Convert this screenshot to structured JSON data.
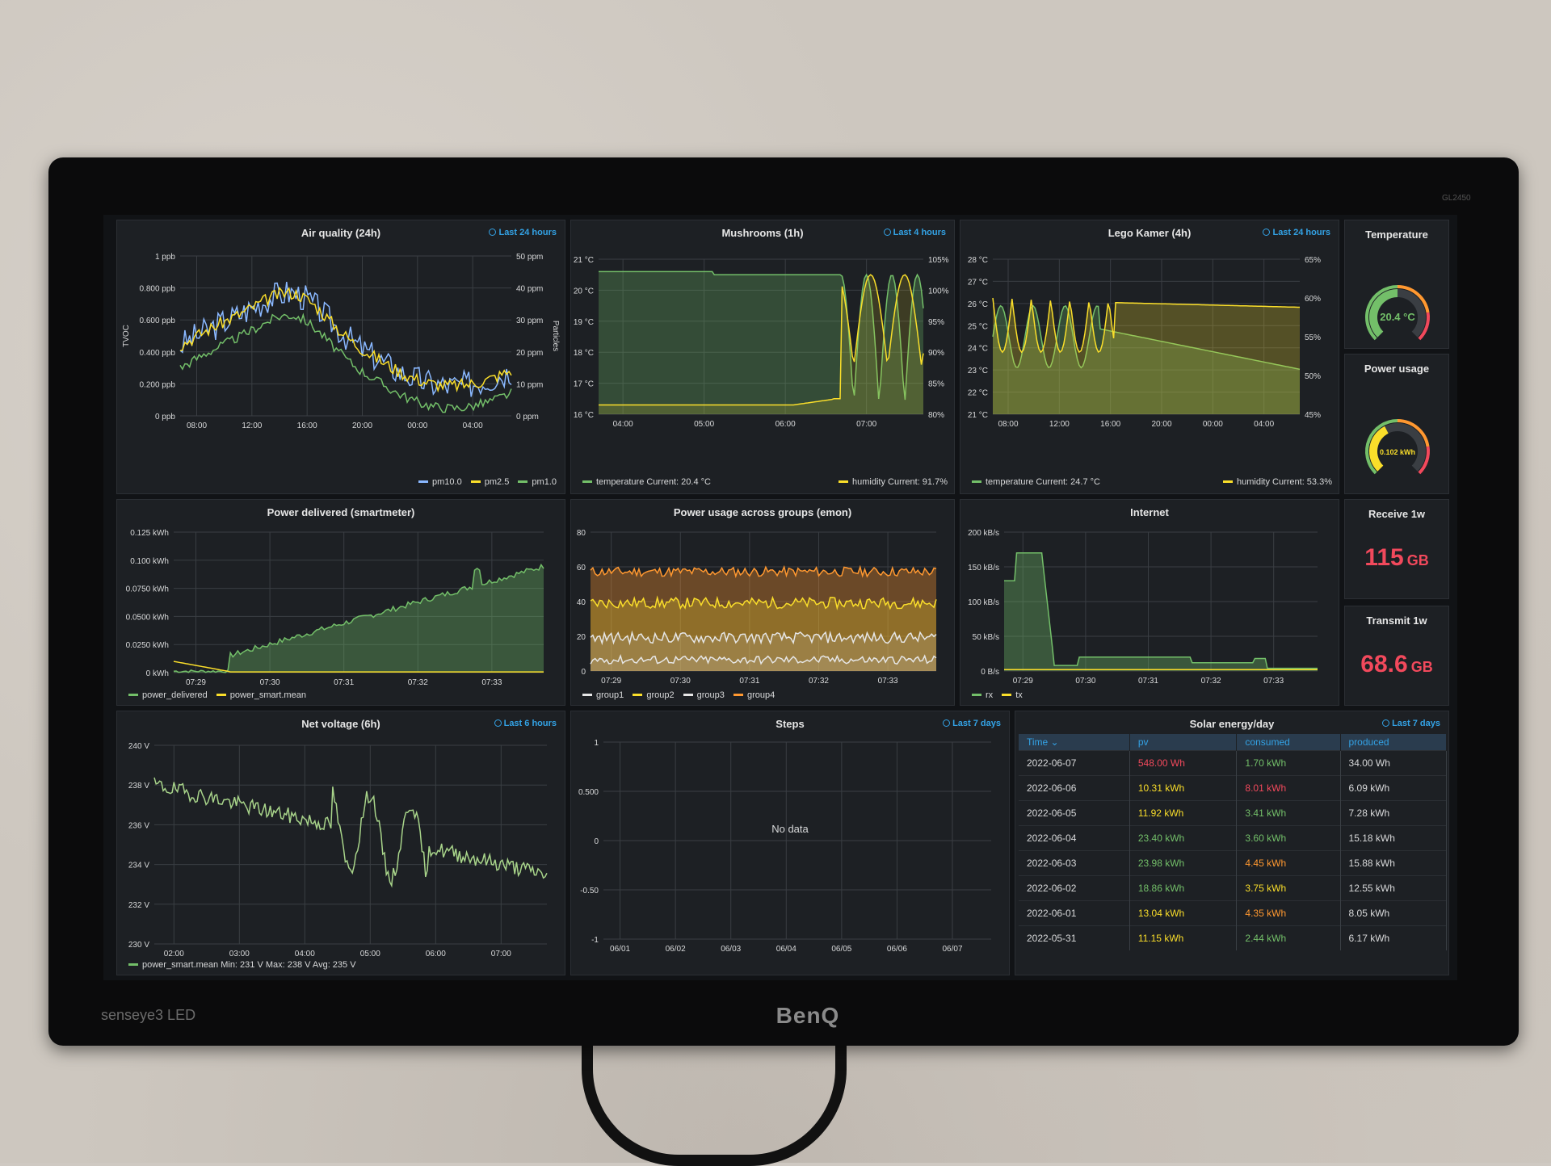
{
  "colors": {
    "green": "#73bf69",
    "yellow": "#fade2a",
    "orange": "#ff9830",
    "red": "#f2495c",
    "cyan": "#5794f2",
    "blue": "#33a2e5",
    "grid": "#3a3e43"
  },
  "monitor": {
    "brand": "BenQ",
    "left_label": "senseye3 LED",
    "model": "GL2450"
  },
  "air_quality": {
    "title": "Air quality (24h)",
    "range": "Last 24 hours",
    "y_left": [
      "1 ppb",
      "0.800 ppb",
      "0.600 ppb",
      "0.400 ppb",
      "0.200 ppb",
      "0 ppb"
    ],
    "y_right": [
      "50 ppm",
      "40 ppm",
      "30 ppm",
      "20 ppm",
      "10 ppm",
      "0 ppm"
    ],
    "y_left_label": "TVOC",
    "y_right_label": "Particles",
    "x": [
      "08:00",
      "12:00",
      "16:00",
      "20:00",
      "00:00",
      "04:00"
    ],
    "legend": [
      "pm10.0",
      "pm2.5",
      "pm1.0"
    ]
  },
  "mushrooms": {
    "title": "Mushrooms (1h)",
    "range": "Last 4 hours",
    "y_left": [
      "21 °C",
      "20 °C",
      "19 °C",
      "18 °C",
      "17 °C",
      "16 °C"
    ],
    "y_right": [
      "105%",
      "100%",
      "95%",
      "90%",
      "85%",
      "80%"
    ],
    "x": [
      "04:00",
      "05:00",
      "06:00",
      "07:00"
    ],
    "legend_left": "temperature  Current: 20.4 °C",
    "legend_right": "humidity  Current: 91.7%"
  },
  "lego": {
    "title": "Lego Kamer (4h)",
    "range": "Last 24 hours",
    "y_left": [
      "28 °C",
      "27 °C",
      "26 °C",
      "25 °C",
      "24 °C",
      "23 °C",
      "22 °C",
      "21 °C"
    ],
    "y_right": [
      "65%",
      "60%",
      "55%",
      "50%",
      "45%"
    ],
    "x": [
      "08:00",
      "12:00",
      "16:00",
      "20:00",
      "00:00",
      "04:00"
    ],
    "legend_left": "temperature  Current: 24.7 °C",
    "legend_right": "humidity  Current: 53.3%"
  },
  "temperature_gauge": {
    "title": "Temperature",
    "value": "20.4 °C",
    "fraction": 0.5
  },
  "power_gauge": {
    "title": "Power usage",
    "value": "0.102 kWh",
    "fraction": 0.4
  },
  "power_delivered": {
    "title": "Power delivered (smartmeter)",
    "y": [
      "0.125 kWh",
      "0.100 kWh",
      "0.0750 kWh",
      "0.0500 kWh",
      "0.0250 kWh",
      "0 kWh"
    ],
    "x": [
      "07:29",
      "07:30",
      "07:31",
      "07:32",
      "07:33"
    ],
    "legend": [
      "power_delivered",
      "power_smart.mean"
    ]
  },
  "power_groups": {
    "title": "Power usage across groups (emon)",
    "y": [
      "80",
      "60",
      "40",
      "20",
      "0"
    ],
    "x": [
      "07:29",
      "07:30",
      "07:31",
      "07:32",
      "07:33"
    ],
    "legend": [
      "group1",
      "group2",
      "group3",
      "group4"
    ]
  },
  "internet": {
    "title": "Internet",
    "y": [
      "200 kB/s",
      "150 kB/s",
      "100 kB/s",
      "50 kB/s",
      "0 B/s"
    ],
    "x": [
      "07:29",
      "07:30",
      "07:31",
      "07:32",
      "07:33"
    ],
    "legend": [
      "rx",
      "tx"
    ]
  },
  "receive": {
    "title": "Receive 1w",
    "value": "115",
    "unit": "GB"
  },
  "transmit": {
    "title": "Transmit 1w",
    "value": "68.6",
    "unit": "GB"
  },
  "net_voltage": {
    "title": "Net voltage (6h)",
    "range": "Last 6 hours",
    "y": [
      "240 V",
      "238 V",
      "236 V",
      "234 V",
      "232 V",
      "230 V"
    ],
    "x": [
      "02:00",
      "03:00",
      "04:00",
      "05:00",
      "06:00",
      "07:00"
    ],
    "legend": "power_smart.mean  Min: 231 V  Max: 238 V  Avg: 235 V"
  },
  "steps": {
    "title": "Steps",
    "range": "Last 7 days",
    "y": [
      "1",
      "0.500",
      "0",
      "-0.50",
      "-1"
    ],
    "x": [
      "06/01",
      "06/02",
      "06/03",
      "06/04",
      "06/05",
      "06/06",
      "06/07"
    ],
    "nodata": "No data"
  },
  "solar": {
    "title": "Solar energy/day",
    "range": "Last 7 days",
    "headers": [
      "Time ⌄",
      "pv",
      "consumed",
      "produced"
    ],
    "rows": [
      [
        "2022-06-07",
        "548.00 Wh",
        "1.70 kWh",
        "34.00 Wh"
      ],
      [
        "2022-06-06",
        "10.31 kWh",
        "8.01 kWh",
        "6.09 kWh"
      ],
      [
        "2022-06-05",
        "11.92 kWh",
        "3.41 kWh",
        "7.28 kWh"
      ],
      [
        "2022-06-04",
        "23.40 kWh",
        "3.60 kWh",
        "15.18 kWh"
      ],
      [
        "2022-06-03",
        "23.98 kWh",
        "4.45 kWh",
        "15.88 kWh"
      ],
      [
        "2022-06-02",
        "18.86 kWh",
        "3.75 kWh",
        "12.55 kWh"
      ],
      [
        "2022-06-01",
        "13.04 kWh",
        "4.35 kWh",
        "8.05 kWh"
      ],
      [
        "2022-05-31",
        "11.15 kWh",
        "2.44 kWh",
        "6.17 kWh"
      ]
    ],
    "row_colors": [
      [
        "#d8d9da",
        "#f2495c",
        "#73bf69",
        "#d8d9da"
      ],
      [
        "#d8d9da",
        "#fade2a",
        "#f2495c",
        "#d8d9da"
      ],
      [
        "#d8d9da",
        "#fade2a",
        "#73bf69",
        "#d8d9da"
      ],
      [
        "#d8d9da",
        "#73bf69",
        "#73bf69",
        "#d8d9da"
      ],
      [
        "#d8d9da",
        "#73bf69",
        "#ff9830",
        "#d8d9da"
      ],
      [
        "#d8d9da",
        "#73bf69",
        "#fade2a",
        "#d8d9da"
      ],
      [
        "#d8d9da",
        "#fade2a",
        "#ff9830",
        "#d8d9da"
      ],
      [
        "#d8d9da",
        "#fade2a",
        "#73bf69",
        "#d8d9da"
      ]
    ]
  }
}
